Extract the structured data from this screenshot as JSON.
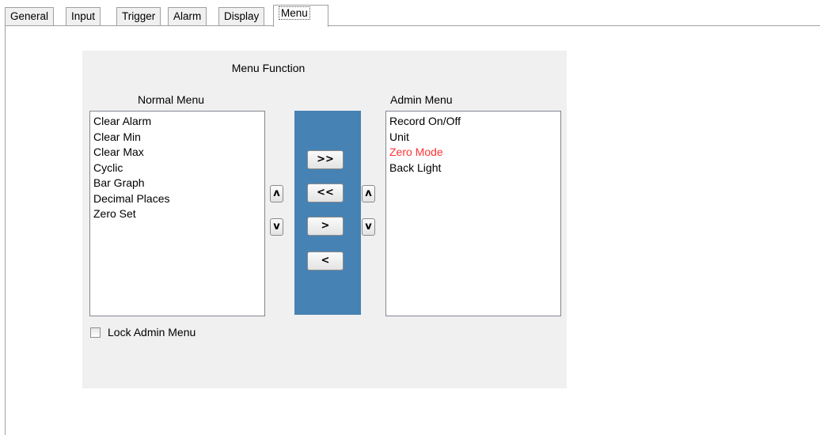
{
  "tabs": [
    {
      "label": "General"
    },
    {
      "label": "Input"
    },
    {
      "label": "Trigger"
    },
    {
      "label": "Alarm"
    },
    {
      "label": "Display"
    },
    {
      "label": "Menu",
      "active": true
    }
  ],
  "menu_function": {
    "title": "Menu Function",
    "normal_menu": {
      "title": "Normal Menu",
      "items": [
        "Clear Alarm",
        "Clear Min",
        "Clear Max",
        "Cyclic",
        "Bar Graph",
        "Decimal Places",
        "Zero Set"
      ]
    },
    "admin_menu": {
      "title": "Admin Menu",
      "items": [
        "Record On/Off",
        "Unit",
        "Zero Mode",
        "Back Light"
      ],
      "highlighted_item": "Zero Mode",
      "highlight_color": "#ff3333"
    },
    "buttons": {
      "move_all_right": ">>",
      "move_all_left": "<<",
      "move_right": ">",
      "move_left": "<",
      "up": "ʌ",
      "down": "v"
    },
    "transfer_panel_color": "#4682b4",
    "lock_admin_menu": {
      "label": "Lock Admin Menu",
      "checked": false
    }
  }
}
